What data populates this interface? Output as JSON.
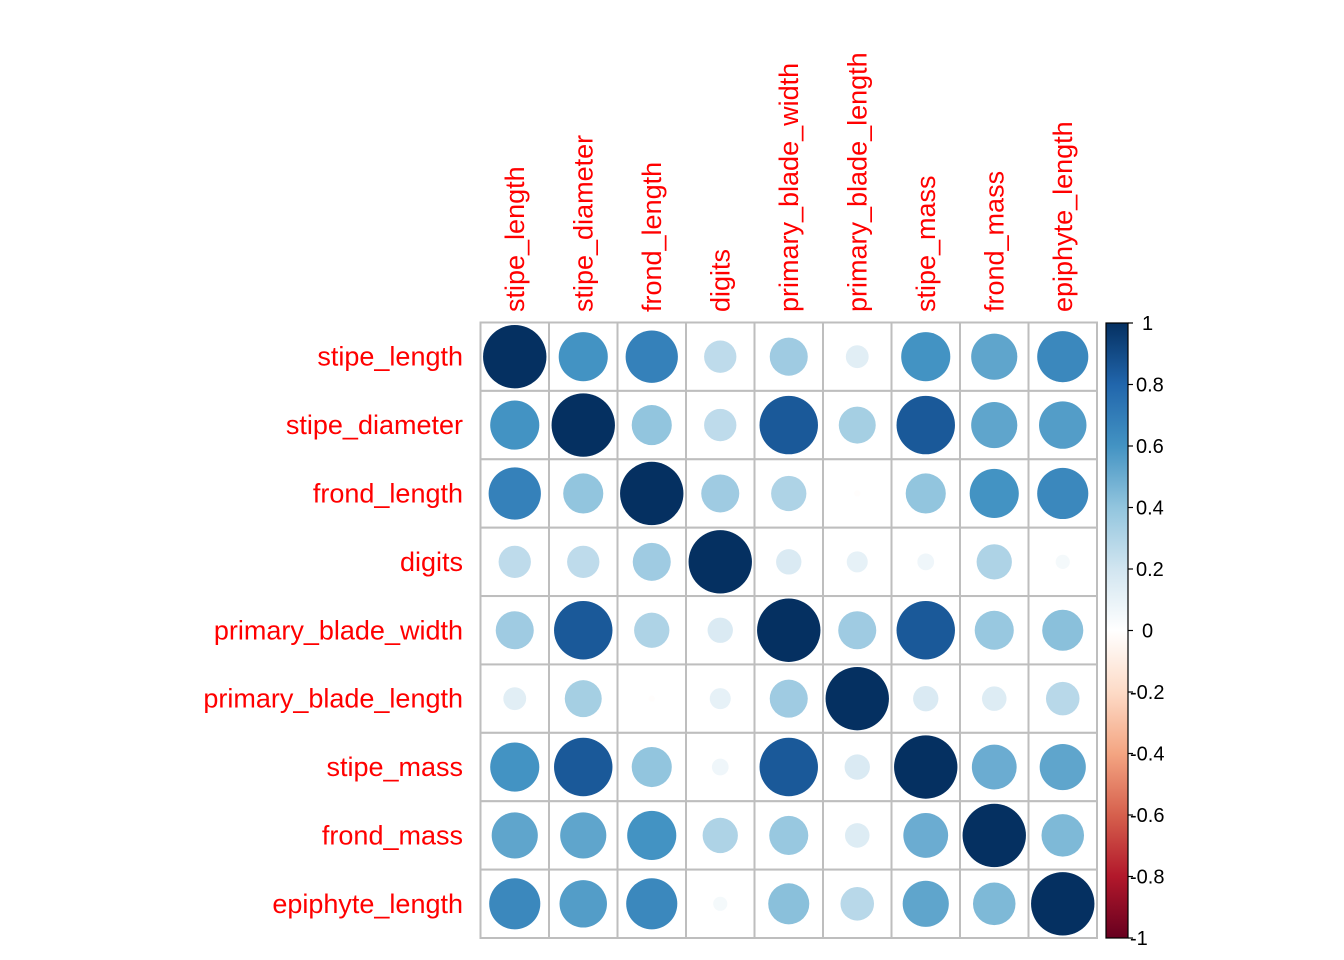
{
  "chart_data": {
    "type": "heatmap",
    "subtype": "correlation-circles",
    "title": "",
    "variables": [
      "stipe_length",
      "stipe_diameter",
      "frond_length",
      "digits",
      "primary_blade_width",
      "primary_blade_length",
      "stipe_mass",
      "frond_mass",
      "epiphyte_length"
    ],
    "matrix": [
      [
        1.0,
        0.6,
        0.68,
        0.26,
        0.36,
        0.13,
        0.6,
        0.53,
        0.65
      ],
      [
        0.6,
        1.0,
        0.4,
        0.26,
        0.85,
        0.34,
        0.85,
        0.53,
        0.56
      ],
      [
        0.68,
        0.4,
        1.0,
        0.36,
        0.31,
        -0.01,
        0.4,
        0.6,
        0.65
      ],
      [
        0.26,
        0.26,
        0.36,
        1.0,
        0.16,
        0.11,
        0.07,
        0.31,
        0.05
      ],
      [
        0.36,
        0.85,
        0.31,
        0.16,
        1.0,
        0.36,
        0.85,
        0.38,
        0.42
      ],
      [
        0.13,
        0.34,
        -0.01,
        0.11,
        0.36,
        1.0,
        0.16,
        0.15,
        0.28
      ],
      [
        0.6,
        0.85,
        0.4,
        0.07,
        0.85,
        0.16,
        1.0,
        0.5,
        0.53
      ],
      [
        0.53,
        0.53,
        0.6,
        0.31,
        0.38,
        0.15,
        0.5,
        1.0,
        0.45
      ],
      [
        0.65,
        0.56,
        0.65,
        0.05,
        0.42,
        0.28,
        0.53,
        0.45,
        1.0
      ]
    ],
    "value_range": [
      -1,
      1
    ],
    "colorbar": {
      "ticks": [
        1,
        0.8,
        0.6,
        0.4,
        0.2,
        0,
        -0.2,
        -0.4,
        -0.6,
        -0.8,
        -1
      ],
      "tick_labels": [
        "1",
        "0.8",
        "0.6",
        "0.4",
        "0.2",
        "0",
        "-0.2",
        "-0.4",
        "-0.6",
        "-0.8",
        "-1"
      ],
      "placement": "right",
      "palette": [
        "#67001F",
        "#B2182B",
        "#D6604D",
        "#F4A582",
        "#FDDBC7",
        "#FFFFFF",
        "#D1E5F0",
        "#92C5DE",
        "#4393C3",
        "#2166AC",
        "#053061"
      ]
    },
    "label_color": "#FF0000",
    "grid_color": "#BEBEBE",
    "column_labels_orientation": "vertical",
    "xlabel": "",
    "ylabel": ""
  }
}
